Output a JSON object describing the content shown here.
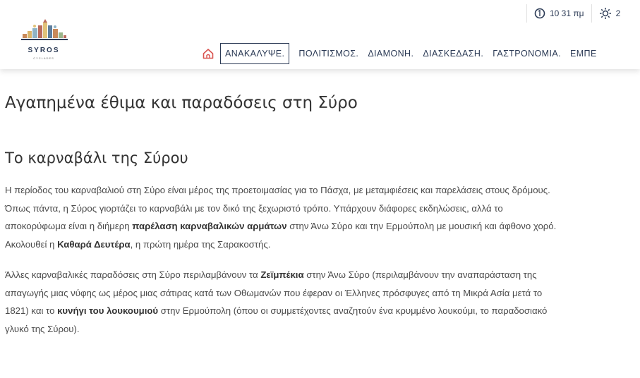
{
  "brand": {
    "name": "SYROS",
    "subtitle": "CYCLADES"
  },
  "utility": {
    "time": "10 31 πμ",
    "weather": "2"
  },
  "nav": {
    "items": [
      {
        "label": "ΑΝΑΚΑΛΥΨΕ.",
        "active": true
      },
      {
        "label": "ΠΟΛΙΤΙΣΜΟΣ."
      },
      {
        "label": "ΔΙΑΜΟΝΗ."
      },
      {
        "label": "ΔΙΑΣΚΕΔΑΣΗ."
      },
      {
        "label": "ΓΑΣΤΡΟΝΟΜΙΑ."
      },
      {
        "label": "ΕΜΠΕ"
      }
    ]
  },
  "page": {
    "title": "Αγαπημένα έθιμα και παραδόσεις στη Σύρο",
    "section_title": "Το καρναβάλι της Σύρου",
    "p1": {
      "l1": "Η περίοδος του καρναβαλιού στη Σύρο είναι μέρος της προετοιμασίας για το Πάσχα, με μεταμφιέσεις και παρελάσεις στους δρόμους.",
      "l2": "Όπως πάντα, η Σύρος γιορτάζει το καρναβάλι με τον δικό της ξεχωριστό τρόπο. Υπάρχουν διάφορες εκδηλώσεις, αλλά το",
      "l3a": "αποκορύφωμα είναι η διήμερη ",
      "l3b": "παρέλαση καρναβαλικών αρμάτων",
      "l3c": " στην Άνω Σύρο και την Ερμούπολη με μουσική και άφθονο χορό.",
      "l4a": "Ακολουθεί η ",
      "l4b": "Καθαρά Δευτέρα",
      "l4c": ", η πρώτη ημέρα της Σαρακοστής."
    },
    "p2": {
      "l1a": "Άλλες καρναβαλικές παραδόσεις στη Σύρο περιλαμβάνουν τα ",
      "l1b": "Ζεϊμπέκια",
      "l1c": " στην Άνω Σύρο (περιλαμβάνουν την αναπαράσταση της",
      "l2": "απαγωγής μιας νύφης ως μέρος μιας σάτιρας κατά των Οθωμανών που έφεραν οι Έλληνες πρόσφυγες από τη Μικρά Ασία μετά το",
      "l3a": "1821) και το ",
      "l3b": "κυνήγι του λουκουμιού",
      "l3c": " στην Ερμούπολη (όπου οι συμμετέχοντες αναζητούν ένα κρυμμένο λουκούμι, το παραδοσιακό",
      "l4": "γλυκό της Σύρου)."
    }
  }
}
